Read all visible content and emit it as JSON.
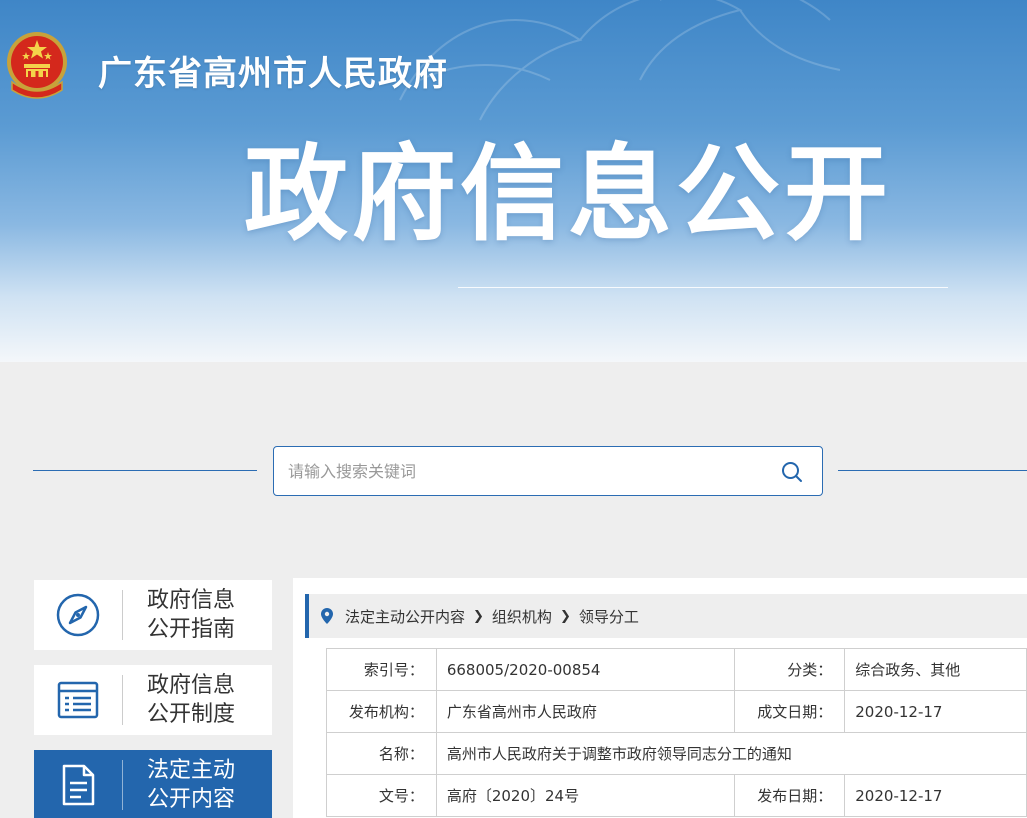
{
  "header": {
    "site_title": "广东省高州市人民政府",
    "banner_title": "政府信息公开"
  },
  "search": {
    "placeholder": "请输入搜索关键词"
  },
  "sidebar": {
    "items": [
      {
        "line1": "政府信息",
        "line2": "公开指南",
        "icon": "compass-icon",
        "active": false
      },
      {
        "line1": "政府信息",
        "line2": "公开制度",
        "icon": "document-list-icon",
        "active": false
      },
      {
        "line1": "法定主动",
        "line2": "公开内容",
        "icon": "file-text-icon",
        "active": true
      }
    ]
  },
  "breadcrumb": {
    "items": [
      "法定主动公开内容",
      "组织机构",
      "领导分工"
    ]
  },
  "meta": {
    "index_label": "索引号：",
    "index_value": "668005/2020-00854",
    "category_label": "分类：",
    "category_value": "综合政务、其他",
    "publisher_label": "发布机构：",
    "publisher_value": "广东省高州市人民政府",
    "created_label": "成文日期：",
    "created_value": "2020-12-17",
    "name_label": "名称：",
    "name_value": "高州市人民政府关于调整市政府领导同志分工的通知",
    "docno_label": "文号：",
    "docno_value": "高府〔2020〕24号",
    "published_label": "发布日期：",
    "published_value": "2020-12-17"
  },
  "colors": {
    "primary": "#2366ad",
    "banner_top": "#3f86c7",
    "background": "#eeeeee"
  }
}
